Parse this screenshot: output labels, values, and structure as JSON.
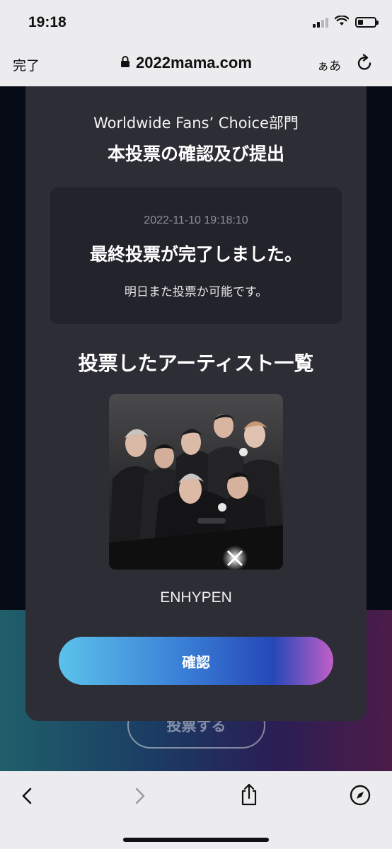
{
  "status_bar": {
    "time": "19:18",
    "icons": [
      "cellular-signal-icon",
      "wifi-icon",
      "battery-icon"
    ],
    "battery_level": 0.3
  },
  "browser": {
    "done_label": "完了",
    "url": "2022mama.com",
    "text_size_label": "ぁあ",
    "icons": [
      "lock-icon",
      "reload-icon"
    ]
  },
  "background_page": {
    "vote_button_label": "投票する"
  },
  "modal": {
    "subtitle": "Worldwide Fans’ Choice部門",
    "title": "本投票の確認及び提出",
    "info": {
      "datetime": "2022-11-10 19:18:10",
      "message": "最終投票が完了しました。",
      "note": "明日また投票か可能です。"
    },
    "list_heading": "投票したアーティスト一覧",
    "artist": {
      "name": "ENHYPEN",
      "photo": "artist-group-photo"
    },
    "confirm_label": "確認"
  },
  "toolbar": {
    "icons": [
      "back-icon",
      "forward-icon",
      "share-icon",
      "compass-icon"
    ]
  },
  "colors": {
    "modal_bg": "#2d2e35",
    "info_box_bg": "#23242b",
    "confirm_gradient": [
      "#5bc2ea",
      "#2548b8",
      "#c25fc8"
    ],
    "page_bg": "#070b15"
  }
}
